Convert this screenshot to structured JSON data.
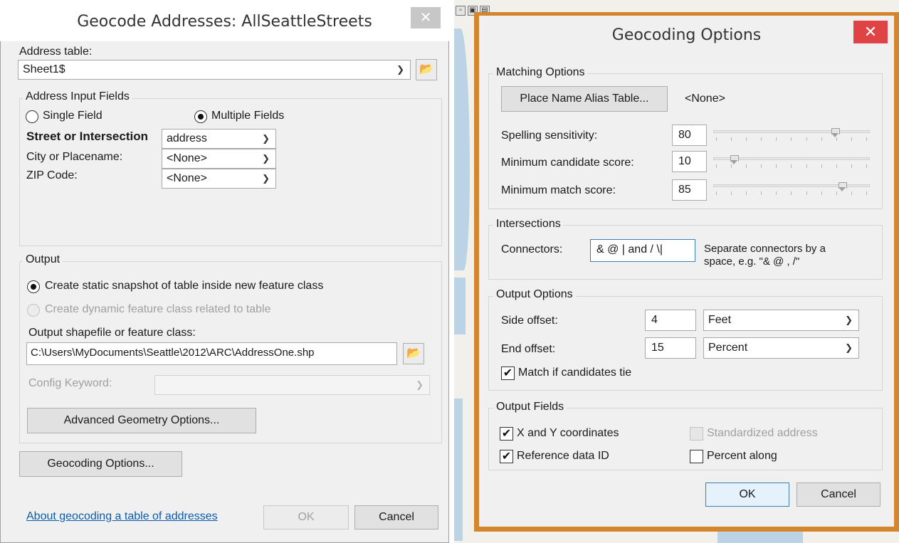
{
  "geocode_dialog": {
    "title": "Geocode Addresses:  AllSeattleStreets",
    "close_glyph": "✕",
    "address_table_label": "Address table:",
    "address_table_value": "Sheet1$",
    "input_fields_group": "Address Input Fields",
    "single_field_label": "Single Field",
    "multiple_fields_label": "Multiple Fields",
    "selected_mode": "multiple",
    "fields": [
      {
        "label": "Street or Intersection",
        "value": "address"
      },
      {
        "label": "City or Placename:",
        "value": "<None>"
      },
      {
        "label": "ZIP Code:",
        "value": "<None>"
      }
    ],
    "output_group": "Output",
    "static_snapshot_label": "Create static snapshot of table inside new feature class",
    "dynamic_class_label": "Create dynamic feature class related to table",
    "output_path_label": "Output shapefile or feature class:",
    "output_path_value": "C:\\Users\\MyDocuments\\Seattle\\2012\\ARC\\AddressOne.shp",
    "config_keyword_label": "Config Keyword:",
    "config_keyword_value": "",
    "advanced_geometry_button": "Advanced Geometry Options...",
    "geocoding_options_button": "Geocoding Options...",
    "about_link": "About geocoding a table of addresses",
    "ok_button": "OK",
    "cancel_button": "Cancel"
  },
  "options_dialog": {
    "title": "Geocoding Options",
    "close_glyph": "✕",
    "matching_group": "Matching Options",
    "alias_table_button": "Place Name Alias Table...",
    "alias_table_value": "<None>",
    "sliders": [
      {
        "label": "Spelling sensitivity:",
        "value": "80",
        "level": 0.8
      },
      {
        "label": "Minimum candidate score:",
        "value": "10",
        "level": 0.1
      },
      {
        "label": "Minimum match score:",
        "value": "85",
        "level": 0.85
      }
    ],
    "intersections_group": "Intersections",
    "connectors_label": "Connectors:",
    "connectors_value": "& @ | and / \\|",
    "connectors_hint_1": "Separate connectors by a",
    "connectors_hint_2": "space, e.g. \"& @ , /\"",
    "output_options_group": "Output Options",
    "side_offset_label": "Side offset:",
    "side_offset_value": "4",
    "side_offset_unit": "Feet",
    "end_offset_label": "End offset:",
    "end_offset_value": "15",
    "end_offset_unit": "Percent",
    "match_tie_label": "Match if candidates tie",
    "match_tie_checked": true,
    "output_fields_group": "Output Fields",
    "xy_label": "X and Y coordinates",
    "xy_checked": true,
    "refid_label": "Reference data ID",
    "refid_checked": true,
    "standardized_label": "Standardized address",
    "standardized_checked": false,
    "percent_along_label": "Percent along",
    "percent_along_checked": false,
    "ok_button": "OK",
    "cancel_button": "Cancel"
  },
  "icons": {
    "dropdown": "chevron-down-icon",
    "folder": "folder-open-icon",
    "check": "checkmark-icon"
  },
  "colors": {
    "options_border": "#d4862f",
    "close_red": "#e04343",
    "link_blue": "#0b5cad"
  }
}
